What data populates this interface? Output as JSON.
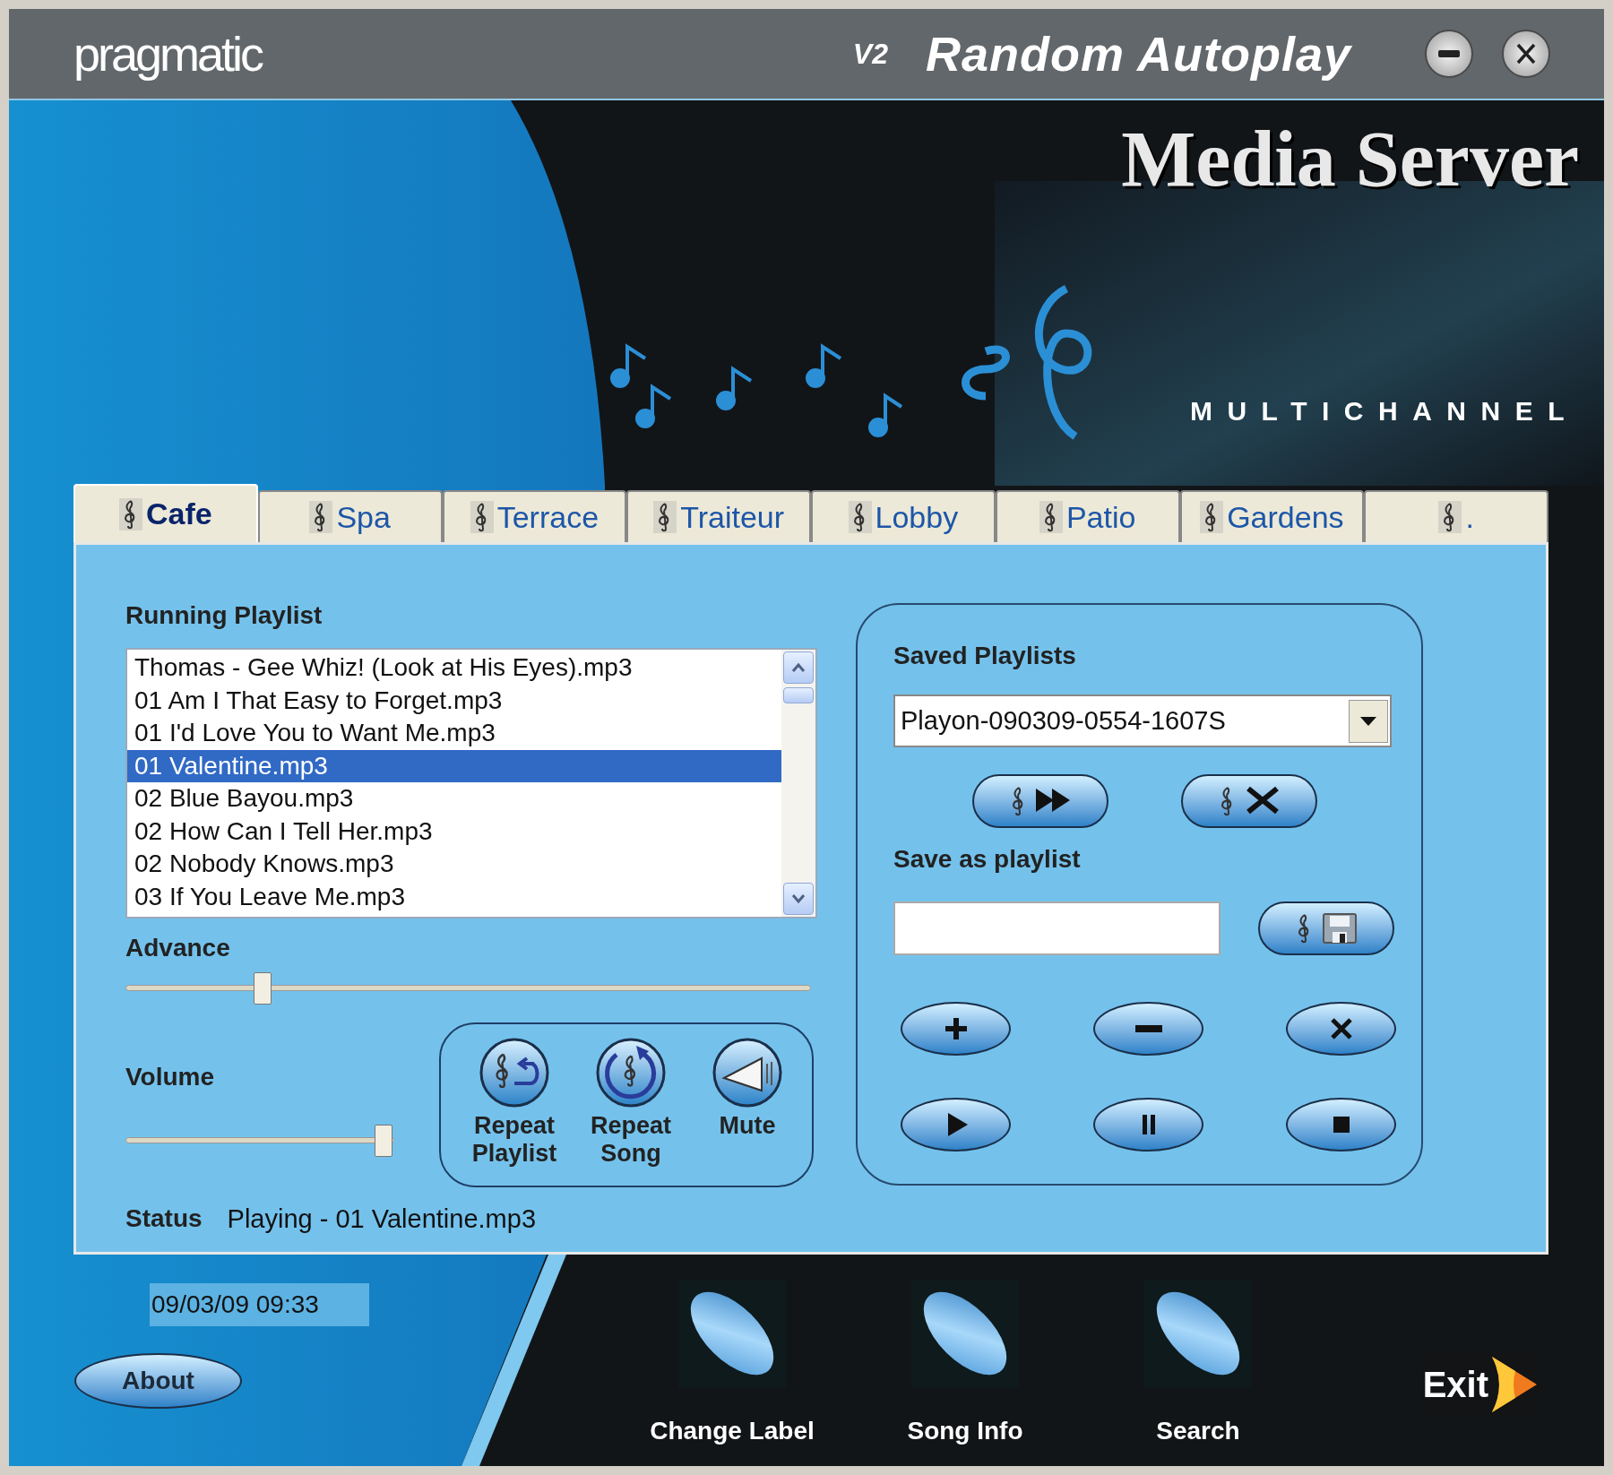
{
  "window": {
    "logo": "pragmatic",
    "version": "V2",
    "title": "Random Autoplay"
  },
  "banner": {
    "title": "Media Server",
    "subtitle": "MULTICHANNEL"
  },
  "tabs": [
    {
      "label": "Cafe",
      "selected": true
    },
    {
      "label": "Spa",
      "selected": false
    },
    {
      "label": "Terrace",
      "selected": false
    },
    {
      "label": "Traiteur",
      "selected": false
    },
    {
      "label": "Lobby",
      "selected": false
    },
    {
      "label": "Patio",
      "selected": false
    },
    {
      "label": "Gardens",
      "selected": false
    },
    {
      "label": ".",
      "selected": false
    }
  ],
  "running_playlist": {
    "label": "Running Playlist",
    "items": [
      {
        "text": "Thomas - Gee Whiz! (Look at His Eyes).mp3",
        "selected": false
      },
      {
        "text": "01 Am I That Easy to Forget.mp3",
        "selected": false
      },
      {
        "text": "01 I'd Love You to Want Me.mp3",
        "selected": false
      },
      {
        "text": "01 Valentine.mp3",
        "selected": true
      },
      {
        "text": "02 Blue Bayou.mp3",
        "selected": false
      },
      {
        "text": "02 How Can I Tell Her.mp3",
        "selected": false
      },
      {
        "text": "02 Nobody Knows.mp3",
        "selected": false
      },
      {
        "text": "03 If You Leave Me.mp3",
        "selected": false
      }
    ]
  },
  "advance": {
    "label": "Advance",
    "level": 0.2
  },
  "volume": {
    "label": "Volume",
    "level": 0.96
  },
  "toggles": [
    {
      "kind": "repeat-playlist",
      "label": "Repeat Playlist"
    },
    {
      "kind": "repeat-song",
      "label": "Repeat Song"
    },
    {
      "kind": "mute",
      "label": "Mute"
    }
  ],
  "status": {
    "label": "Status",
    "value": "Playing - 01 Valentine.mp3"
  },
  "saved_playlists": {
    "label": "Saved Playlists",
    "value": "Playon-090309-0554-1607S",
    "buttons": [
      {
        "kind": "load"
      },
      {
        "kind": "delete"
      }
    ]
  },
  "save_as": {
    "label": "Save as playlist",
    "button": {
      "kind": "save"
    }
  },
  "controls": [
    {
      "kind": "add"
    },
    {
      "kind": "remove"
    },
    {
      "kind": "clear"
    },
    {
      "kind": "play"
    },
    {
      "kind": "pause"
    },
    {
      "kind": "stop"
    }
  ],
  "footer": {
    "datetime": "09/03/09 09:33",
    "about": "About",
    "actions": [
      {
        "label": "Change Label"
      },
      {
        "label": "Song Info"
      },
      {
        "label": "Search"
      }
    ],
    "exit": "Exit"
  }
}
